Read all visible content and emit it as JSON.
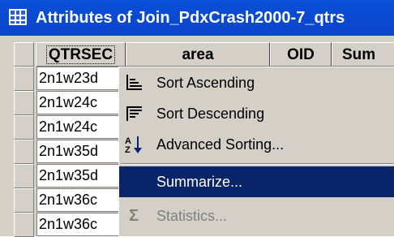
{
  "window": {
    "title": "Attributes of Join_PdxCrash2000-7_qtrs"
  },
  "table": {
    "columns": [
      "QTRSEC",
      "area",
      "OID",
      "Sum"
    ],
    "rows": [
      "2n1w23d",
      "2n1w24c",
      "2n1w24c",
      "2n1w35d",
      "2n1w35d",
      "2n1w36c",
      "2n1w36c"
    ]
  },
  "context_menu": {
    "items": [
      {
        "label": "Sort Ascending",
        "icon": "sort-ascending-icon"
      },
      {
        "label": "Sort Descending",
        "icon": "sort-descending-icon"
      },
      {
        "label": "Advanced Sorting...",
        "icon": "advanced-sort-icon"
      },
      {
        "label": "Summarize...",
        "state": "highlighted"
      },
      {
        "label": "Statistics...",
        "icon": "sigma-icon",
        "state": "disabled"
      }
    ]
  },
  "colors": {
    "titlebar": "#0a4fd8",
    "menu_highlight": "#0a246a",
    "face": "#d4d0c8"
  }
}
